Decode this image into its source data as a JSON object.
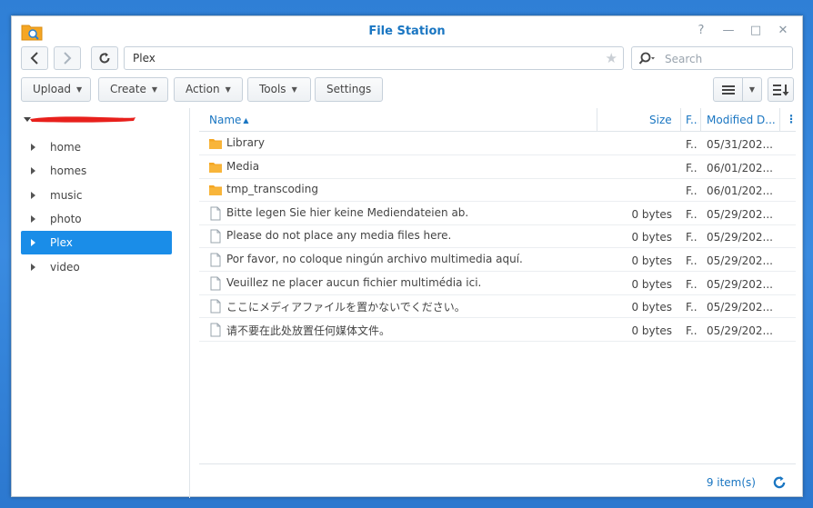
{
  "window": {
    "title": "File Station"
  },
  "window_controls": {
    "help": "?",
    "minimize": "—",
    "maximize": "□",
    "close": "✕"
  },
  "nav": {
    "path": "Plex",
    "search_placeholder": "Search"
  },
  "toolbar": {
    "upload": "Upload",
    "create": "Create",
    "action": "Action",
    "tools": "Tools",
    "settings": "Settings"
  },
  "tree": {
    "items": [
      {
        "label": "home"
      },
      {
        "label": "homes"
      },
      {
        "label": "music"
      },
      {
        "label": "photo"
      },
      {
        "label": "Plex"
      },
      {
        "label": "video"
      }
    ],
    "selected": "Plex"
  },
  "columns": {
    "name": "Name",
    "size": "Size",
    "type": "F...",
    "modified": "Modified D...",
    "more": "⋮"
  },
  "files": [
    {
      "name": "Library",
      "size": "",
      "type": "F...",
      "modified": "05/31/202...",
      "kind": "folder"
    },
    {
      "name": "Media",
      "size": "",
      "type": "F...",
      "modified": "06/01/202...",
      "kind": "folder"
    },
    {
      "name": "tmp_transcoding",
      "size": "",
      "type": "F...",
      "modified": "06/01/202...",
      "kind": "folder"
    },
    {
      "name": "Bitte legen Sie hier keine Mediendateien ab.",
      "size": "0 bytes",
      "type": "F...",
      "modified": "05/29/202...",
      "kind": "file"
    },
    {
      "name": "Please do not place any media files here.",
      "size": "0 bytes",
      "type": "F...",
      "modified": "05/29/202...",
      "kind": "file"
    },
    {
      "name": "Por favor, no coloque ningún archivo multimedia aquí.",
      "size": "0 bytes",
      "type": "F...",
      "modified": "05/29/202...",
      "kind": "file"
    },
    {
      "name": "Veuillez ne placer aucun fichier multimédia ici.",
      "size": "0 bytes",
      "type": "F...",
      "modified": "05/29/202...",
      "kind": "file"
    },
    {
      "name": "ここにメディアファイルを置かないでください。",
      "size": "0 bytes",
      "type": "F...",
      "modified": "05/29/202...",
      "kind": "file"
    },
    {
      "name": "请不要在此处放置任何媒体文件。",
      "size": "0 bytes",
      "type": "F...",
      "modified": "05/29/202...",
      "kind": "file"
    }
  ],
  "footer": {
    "count": "9 item(s)"
  },
  "colors": {
    "accent": "#1a76c2",
    "selected": "#1a8de8",
    "folder": "#f5a623",
    "redaction": "#e8201c",
    "desktop": "#2f7fd6"
  }
}
